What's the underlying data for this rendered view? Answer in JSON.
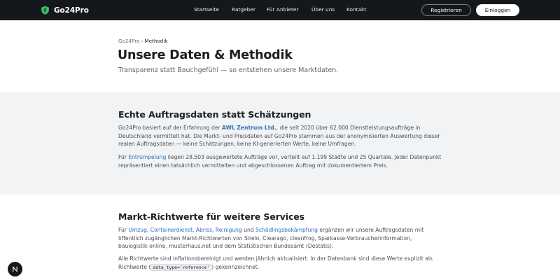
{
  "header": {
    "brand_name": "Go24Pro",
    "nav": [
      "Startseite",
      "Ratgeber",
      "Für Anbieter",
      "Über uns",
      "Kontakt"
    ],
    "register_label": "Registrieren",
    "login_label": "Einloggen"
  },
  "breadcrumb": {
    "root": "Go24Pro",
    "separator": "›",
    "current": "Methodik"
  },
  "page": {
    "title": "Unsere Daten & Methodik",
    "subtitle": "Transparenz statt Bauchgefühl — so entstehen unsere Marktdaten."
  },
  "section1": {
    "heading": "Echte Auftragsdaten statt Schätzungen",
    "p1_prefix": "Go24Pro basiert auf der Erfahrung der ",
    "p1_link": "AWL Zentrum Ltd.",
    "p1_suffix": ", die seit 2020 über 62.000 Dienstleistungsaufträge in Deutschland vermittelt hat. Die Markt- und Preisdaten auf Go24Pro stammen aus der anonymisierten Auswertung dieser realen Auftragsdaten — keine Schätzungen, keine KI-generierten Werte, keine Umfragen.",
    "p2_prefix": "Für ",
    "p2_link": "Entrümpelung",
    "p2_suffix": " liegen 28.503 ausgewertete Aufträge vor, verteilt auf 1.199 Städte und 25 Quartale. Jeder Datenpunkt repräsentiert einen tatsächlich vermittelten und abgeschlossenen Auftrag mit dokumentiertem Preis."
  },
  "section2": {
    "heading": "Markt-Richtwerte für weitere Services",
    "p1_prefix": "Für ",
    "service_links": [
      "Umzug",
      "Containerdienst",
      "Abriss",
      "Reinigung",
      "Schädlingsbekämpfung"
    ],
    "comma": ", ",
    "and": " und ",
    "p1_suffix": " ergänzen wir unsere Auftragsdaten mit öffentlich zugänglichen Markt-Richtwerten von Sirelo, Clearago, cleanfrog, Sparkasse-Verbraucherinformation, baulogistik-online, musterhaus.net und dem Statistischen Bundesamt (Destatis).",
    "p2_prefix": "Alle Richtwerte sind inflationsbereinigt und werden jährlich aktualisiert. In der Datenbank sind diese Werte explizit als Richtwerte (",
    "p2_code": "data_type='reference'",
    "p2_suffix": ") gekennzeichnet."
  },
  "fab": {
    "letter": "N"
  },
  "colors": {
    "topbar": "#14181c",
    "link": "#2f6fb5",
    "section_gray": "#f1f3f5",
    "logo_green": "#3fb56a"
  },
  "icons": {
    "brand": "shield-leaf-icon",
    "fab": "nextjs-logo-icon"
  }
}
